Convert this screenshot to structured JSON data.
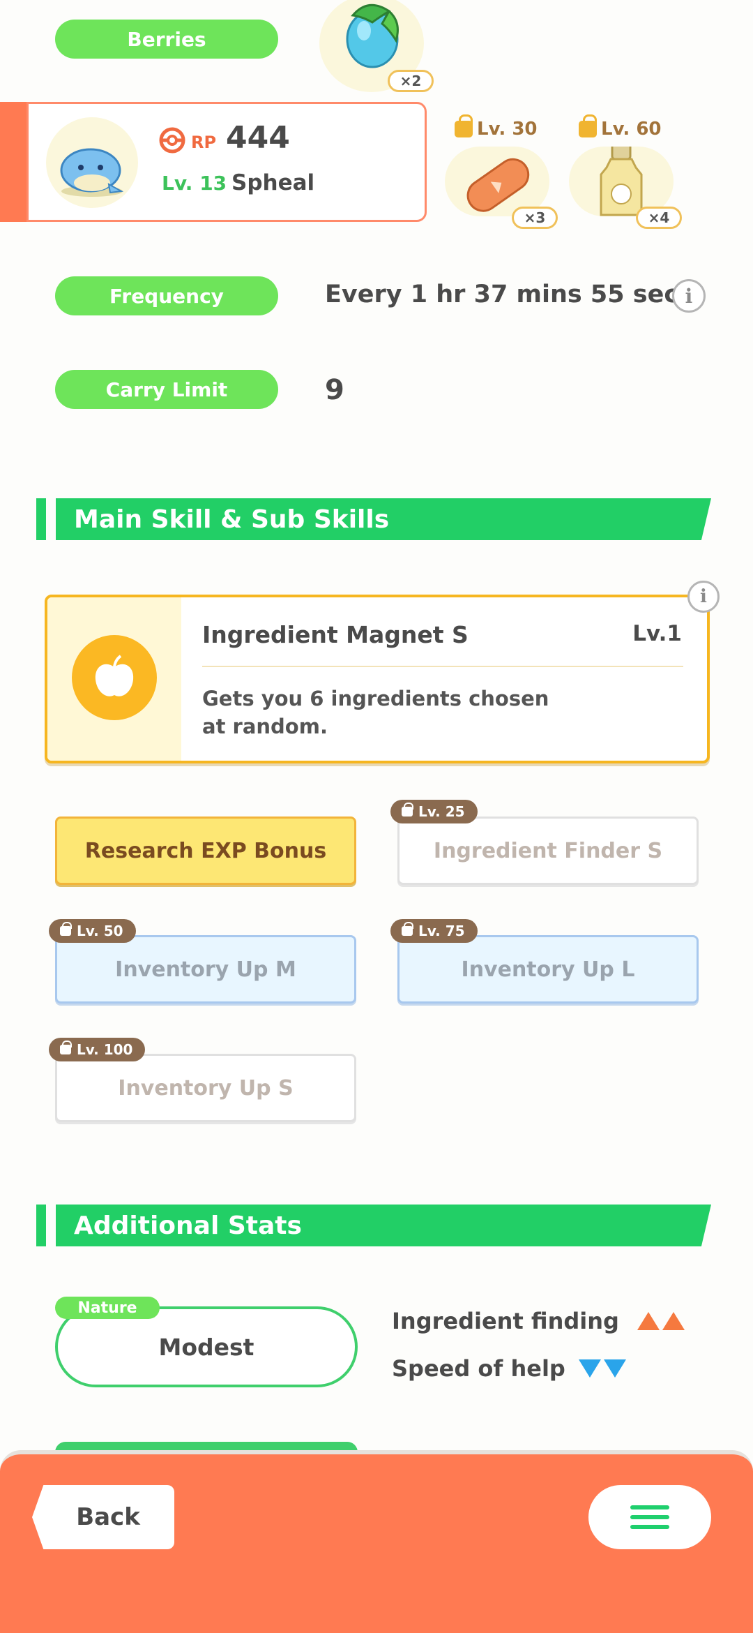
{
  "berries": {
    "label": "Berries",
    "quantity": "×2"
  },
  "pokemon": {
    "rp_label": "RP",
    "rp_value": "444",
    "level": "Lv. 13",
    "name": "Spheal"
  },
  "ingredients": [
    {
      "unlock": "Lv. 30",
      "quantity": "×3"
    },
    {
      "unlock": "Lv. 60",
      "quantity": "×4"
    }
  ],
  "frequency": {
    "label": "Frequency",
    "value": "Every 1 hr 37 mins 55 secs"
  },
  "carry_limit": {
    "label": "Carry Limit",
    "value": "9"
  },
  "main_skill_section": {
    "title": "Main Skill & Sub Skills"
  },
  "main_skill": {
    "name": "Ingredient Magnet S",
    "level": "Lv.1",
    "description_line1": "Gets you 6 ingredients chosen",
    "description_line2": "at random."
  },
  "sub_skills": [
    {
      "name": "Research EXP Bonus",
      "unlock": ""
    },
    {
      "name": "Ingredient Finder S",
      "unlock": "Lv. 25"
    },
    {
      "name": "Inventory Up M",
      "unlock": "Lv. 50"
    },
    {
      "name": "Inventory Up L",
      "unlock": "Lv. 75"
    },
    {
      "name": "Inventory Up S",
      "unlock": "Lv. 100"
    }
  ],
  "additional_stats": {
    "title": "Additional Stats"
  },
  "nature": {
    "label": "Nature",
    "value": "Modest",
    "up_stat": "Ingredient finding",
    "down_stat": "Speed of help",
    "up_color": "#f5793f",
    "down_color": "#2aa4ea"
  },
  "nav": {
    "back_label": "Back",
    "menu_icon": "hamburger-menu-icon"
  },
  "info_icon": "i"
}
